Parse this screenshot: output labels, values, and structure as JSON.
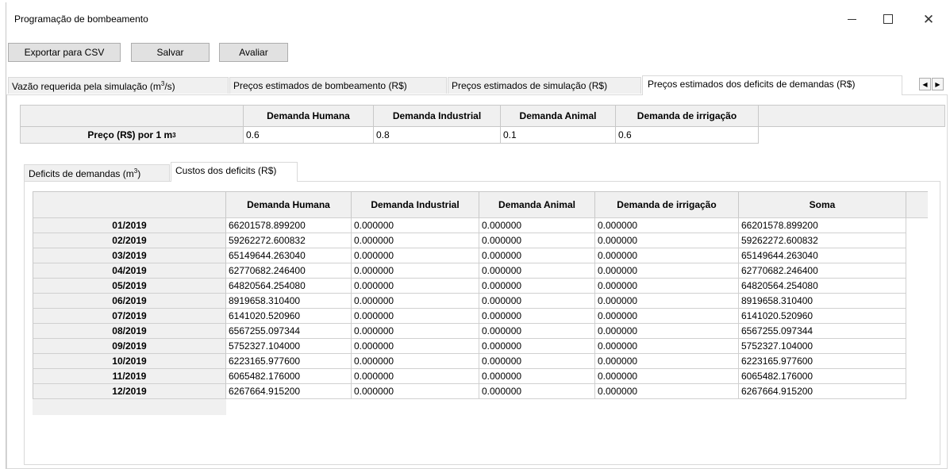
{
  "window": {
    "title": "Programação de bombeamento"
  },
  "window_controls": {
    "minimize": "—",
    "maximize": "☐",
    "close": "✕"
  },
  "toolbar": {
    "export_label": "Exportar para CSV",
    "save_label": "Salvar",
    "evaluate_label": "Avaliar"
  },
  "tabs": [
    {
      "label_main": "Vazão requerida pela simulação (m",
      "label_sup": "3",
      "label_end": "/s)"
    },
    {
      "label": "Preços estimados de bombeamento (R$)"
    },
    {
      "label": "Preços estimados de simulação (R$)"
    },
    {
      "label": "Preços estimados dos deficits de demandas (R$)"
    }
  ],
  "price_table": {
    "headers": [
      "Demanda Humana",
      "Demanda Industrial",
      "Demanda Animal",
      "Demanda de irrigação"
    ],
    "row_label_main": "Preço (R$) por 1 m",
    "row_label_sup": "3",
    "values": [
      "0.6",
      "0.8",
      "0.1",
      "0.6"
    ]
  },
  "inner_tabs": [
    {
      "label_main": "Deficits de demandas (m",
      "label_sup": "3",
      "label_end": ")"
    },
    {
      "label": "Custos dos deficits (R$)"
    }
  ],
  "cost_table": {
    "headers": [
      "Demanda Humana",
      "Demanda Industrial",
      "Demanda Animal",
      "Demanda de irrigação",
      "Soma"
    ],
    "rows": [
      [
        "01/2019",
        "66201578.899200",
        "0.000000",
        "0.000000",
        "0.000000",
        "66201578.899200"
      ],
      [
        "02/2019",
        "59262272.600832",
        "0.000000",
        "0.000000",
        "0.000000",
        "59262272.600832"
      ],
      [
        "03/2019",
        "65149644.263040",
        "0.000000",
        "0.000000",
        "0.000000",
        "65149644.263040"
      ],
      [
        "04/2019",
        "62770682.246400",
        "0.000000",
        "0.000000",
        "0.000000",
        "62770682.246400"
      ],
      [
        "05/2019",
        "64820564.254080",
        "0.000000",
        "0.000000",
        "0.000000",
        "64820564.254080"
      ],
      [
        "06/2019",
        "8919658.310400",
        "0.000000",
        "0.000000",
        "0.000000",
        "8919658.310400"
      ],
      [
        "07/2019",
        "6141020.520960",
        "0.000000",
        "0.000000",
        "0.000000",
        "6141020.520960"
      ],
      [
        "08/2019",
        "6567255.097344",
        "0.000000",
        "0.000000",
        "0.000000",
        "6567255.097344"
      ],
      [
        "09/2019",
        "5752327.104000",
        "0.000000",
        "0.000000",
        "0.000000",
        "5752327.104000"
      ],
      [
        "10/2019",
        "6223165.977600",
        "0.000000",
        "0.000000",
        "0.000000",
        "6223165.977600"
      ],
      [
        "11/2019",
        "6065482.176000",
        "0.000000",
        "0.000000",
        "0.000000",
        "6065482.176000"
      ],
      [
        "12/2019",
        "6267664.915200",
        "0.000000",
        "0.000000",
        "0.000000",
        "6267664.915200"
      ]
    ]
  }
}
